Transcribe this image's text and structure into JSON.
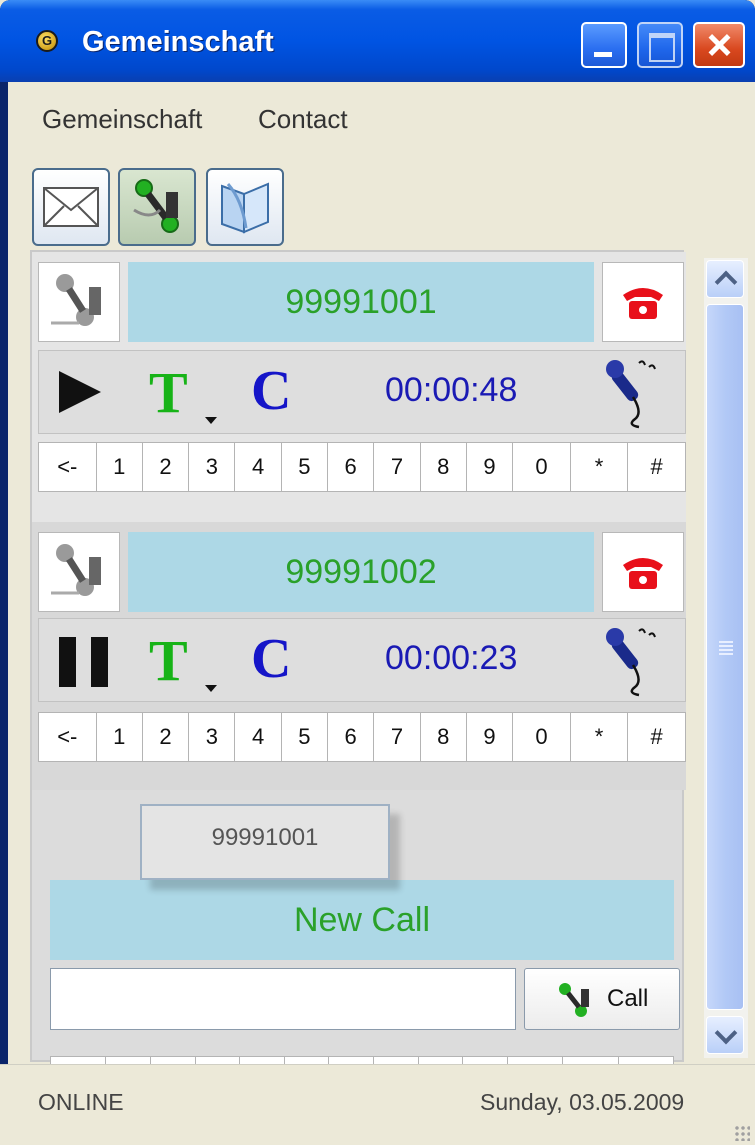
{
  "window": {
    "title": "Gemeinschaft",
    "app_icon_letter": "G"
  },
  "menu": {
    "items": [
      {
        "label": "Gemeinschaft"
      },
      {
        "label": "Contact"
      }
    ]
  },
  "toolbar": {
    "buttons": [
      {
        "icon": "envelope-icon"
      },
      {
        "icon": "phone-handset-green-icon",
        "active": true
      },
      {
        "icon": "address-book-icon"
      }
    ]
  },
  "lines": [
    {
      "number": "99991001",
      "state": "playing",
      "t_label": "T",
      "c_label": "C",
      "timer": "00:00:48"
    },
    {
      "number": "99991002",
      "state": "paused",
      "t_label": "T",
      "c_label": "C",
      "timer": "00:00:23"
    }
  ],
  "keypad": [
    "<-",
    "1",
    "2",
    "3",
    "4",
    "5",
    "6",
    "7",
    "8",
    "9",
    "0",
    "*",
    "#"
  ],
  "keypad_line2_visible": [
    "<-",
    "1",
    "7",
    "8",
    "9",
    "0",
    "*",
    "#"
  ],
  "transfer_popup": {
    "item": "99991001"
  },
  "new_call": {
    "label": "New Call",
    "input_value": "",
    "call_button": "Call"
  },
  "status": {
    "connection": "ONLINE",
    "date": "Sunday, 03.05.2009"
  },
  "colors": {
    "number_bg": "#add8e6",
    "number_text": "#2aa12a",
    "timer_text": "#1a1ab4",
    "titlebar": "#0054e3"
  }
}
